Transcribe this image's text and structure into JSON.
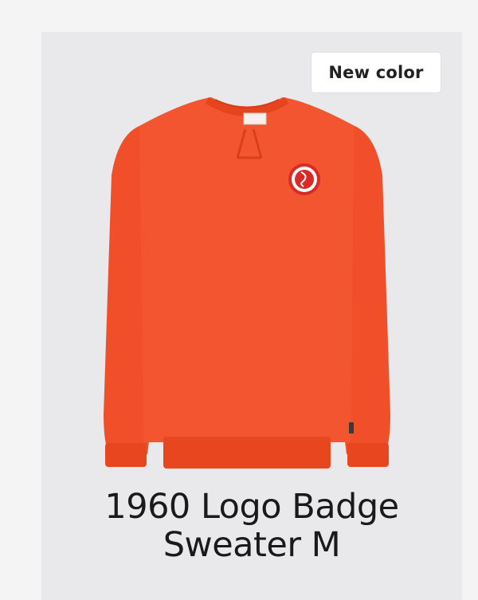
{
  "product": {
    "badge_label": "New color",
    "title_line1": "1960 Logo Badge",
    "title_line2": "Sweater M",
    "color": "#f2532d",
    "image_icon": "sweater-image"
  }
}
